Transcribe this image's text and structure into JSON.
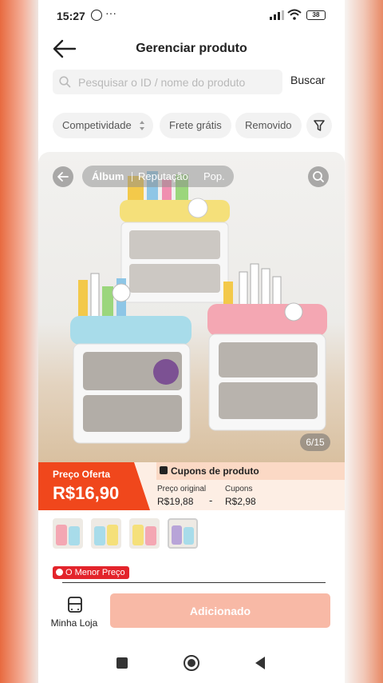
{
  "status_bar": {
    "time": "15:27",
    "battery": "38",
    "dots": "···"
  },
  "header": {
    "title": "Gerenciar produto"
  },
  "search": {
    "placeholder": "Pesquisar o ID / nome do produto",
    "button_label": "Buscar"
  },
  "filters": [
    {
      "label": "Competividade"
    },
    {
      "label": "Frete grátis"
    },
    {
      "label": "Removido"
    }
  ],
  "gallery": {
    "tabs": [
      "Álbum",
      "Reputação",
      "Pop."
    ],
    "counter": "6/15"
  },
  "price": {
    "offer_label": "Preço Oferta",
    "offer_value": "R$16,90",
    "coupons_title": "Cupons de produto",
    "original_label": "Preço original",
    "original_value": "R$19,88",
    "separator": "-",
    "coupons_label": "Cupons",
    "coupons_value": "R$2,98"
  },
  "badge": {
    "lowest_price": "O Menor Preço"
  },
  "bottom": {
    "store_label": "Minha Loja",
    "add_button": "Adicionado"
  },
  "colors": {
    "accent": "#f0471c",
    "button_disabled": "#f8b9a6",
    "badge_red": "#e3242b"
  }
}
